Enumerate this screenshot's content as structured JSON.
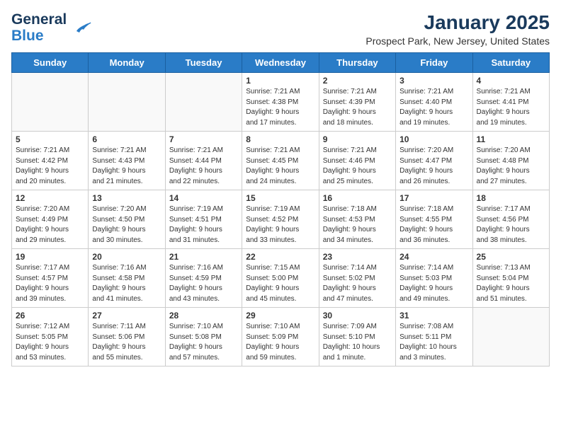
{
  "logo": {
    "line1": "General",
    "line2": "Blue"
  },
  "title": "January 2025",
  "subtitle": "Prospect Park, New Jersey, United States",
  "weekdays": [
    "Sunday",
    "Monday",
    "Tuesday",
    "Wednesday",
    "Thursday",
    "Friday",
    "Saturday"
  ],
  "weeks": [
    [
      {
        "day": "",
        "detail": ""
      },
      {
        "day": "",
        "detail": ""
      },
      {
        "day": "",
        "detail": ""
      },
      {
        "day": "1",
        "detail": "Sunrise: 7:21 AM\nSunset: 4:38 PM\nDaylight: 9 hours\nand 17 minutes."
      },
      {
        "day": "2",
        "detail": "Sunrise: 7:21 AM\nSunset: 4:39 PM\nDaylight: 9 hours\nand 18 minutes."
      },
      {
        "day": "3",
        "detail": "Sunrise: 7:21 AM\nSunset: 4:40 PM\nDaylight: 9 hours\nand 19 minutes."
      },
      {
        "day": "4",
        "detail": "Sunrise: 7:21 AM\nSunset: 4:41 PM\nDaylight: 9 hours\nand 19 minutes."
      }
    ],
    [
      {
        "day": "5",
        "detail": "Sunrise: 7:21 AM\nSunset: 4:42 PM\nDaylight: 9 hours\nand 20 minutes."
      },
      {
        "day": "6",
        "detail": "Sunrise: 7:21 AM\nSunset: 4:43 PM\nDaylight: 9 hours\nand 21 minutes."
      },
      {
        "day": "7",
        "detail": "Sunrise: 7:21 AM\nSunset: 4:44 PM\nDaylight: 9 hours\nand 22 minutes."
      },
      {
        "day": "8",
        "detail": "Sunrise: 7:21 AM\nSunset: 4:45 PM\nDaylight: 9 hours\nand 24 minutes."
      },
      {
        "day": "9",
        "detail": "Sunrise: 7:21 AM\nSunset: 4:46 PM\nDaylight: 9 hours\nand 25 minutes."
      },
      {
        "day": "10",
        "detail": "Sunrise: 7:20 AM\nSunset: 4:47 PM\nDaylight: 9 hours\nand 26 minutes."
      },
      {
        "day": "11",
        "detail": "Sunrise: 7:20 AM\nSunset: 4:48 PM\nDaylight: 9 hours\nand 27 minutes."
      }
    ],
    [
      {
        "day": "12",
        "detail": "Sunrise: 7:20 AM\nSunset: 4:49 PM\nDaylight: 9 hours\nand 29 minutes."
      },
      {
        "day": "13",
        "detail": "Sunrise: 7:20 AM\nSunset: 4:50 PM\nDaylight: 9 hours\nand 30 minutes."
      },
      {
        "day": "14",
        "detail": "Sunrise: 7:19 AM\nSunset: 4:51 PM\nDaylight: 9 hours\nand 31 minutes."
      },
      {
        "day": "15",
        "detail": "Sunrise: 7:19 AM\nSunset: 4:52 PM\nDaylight: 9 hours\nand 33 minutes."
      },
      {
        "day": "16",
        "detail": "Sunrise: 7:18 AM\nSunset: 4:53 PM\nDaylight: 9 hours\nand 34 minutes."
      },
      {
        "day": "17",
        "detail": "Sunrise: 7:18 AM\nSunset: 4:55 PM\nDaylight: 9 hours\nand 36 minutes."
      },
      {
        "day": "18",
        "detail": "Sunrise: 7:17 AM\nSunset: 4:56 PM\nDaylight: 9 hours\nand 38 minutes."
      }
    ],
    [
      {
        "day": "19",
        "detail": "Sunrise: 7:17 AM\nSunset: 4:57 PM\nDaylight: 9 hours\nand 39 minutes."
      },
      {
        "day": "20",
        "detail": "Sunrise: 7:16 AM\nSunset: 4:58 PM\nDaylight: 9 hours\nand 41 minutes."
      },
      {
        "day": "21",
        "detail": "Sunrise: 7:16 AM\nSunset: 4:59 PM\nDaylight: 9 hours\nand 43 minutes."
      },
      {
        "day": "22",
        "detail": "Sunrise: 7:15 AM\nSunset: 5:00 PM\nDaylight: 9 hours\nand 45 minutes."
      },
      {
        "day": "23",
        "detail": "Sunrise: 7:14 AM\nSunset: 5:02 PM\nDaylight: 9 hours\nand 47 minutes."
      },
      {
        "day": "24",
        "detail": "Sunrise: 7:14 AM\nSunset: 5:03 PM\nDaylight: 9 hours\nand 49 minutes."
      },
      {
        "day": "25",
        "detail": "Sunrise: 7:13 AM\nSunset: 5:04 PM\nDaylight: 9 hours\nand 51 minutes."
      }
    ],
    [
      {
        "day": "26",
        "detail": "Sunrise: 7:12 AM\nSunset: 5:05 PM\nDaylight: 9 hours\nand 53 minutes."
      },
      {
        "day": "27",
        "detail": "Sunrise: 7:11 AM\nSunset: 5:06 PM\nDaylight: 9 hours\nand 55 minutes."
      },
      {
        "day": "28",
        "detail": "Sunrise: 7:10 AM\nSunset: 5:08 PM\nDaylight: 9 hours\nand 57 minutes."
      },
      {
        "day": "29",
        "detail": "Sunrise: 7:10 AM\nSunset: 5:09 PM\nDaylight: 9 hours\nand 59 minutes."
      },
      {
        "day": "30",
        "detail": "Sunrise: 7:09 AM\nSunset: 5:10 PM\nDaylight: 10 hours\nand 1 minute."
      },
      {
        "day": "31",
        "detail": "Sunrise: 7:08 AM\nSunset: 5:11 PM\nDaylight: 10 hours\nand 3 minutes."
      },
      {
        "day": "",
        "detail": ""
      }
    ]
  ]
}
